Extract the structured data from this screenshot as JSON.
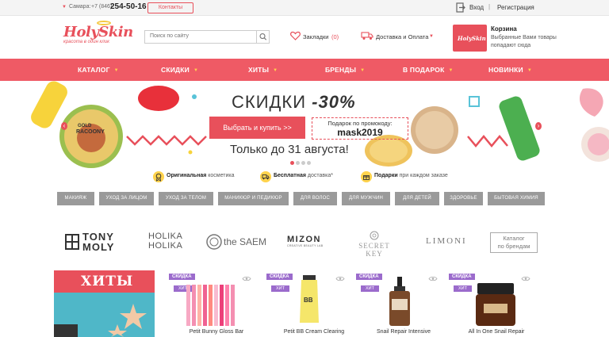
{
  "topbar": {
    "city": "Самара:",
    "phone_prefix": "+7 (846)",
    "phone_main": "254-50-16",
    "contacts": "Контакты",
    "login": "Вход",
    "separator": "|",
    "register": "Регистрация"
  },
  "header": {
    "logo": "HolySkin",
    "logo_sub": "красота в один клик",
    "search_placeholder": "Поиск по сайту",
    "bookmarks_label": "Закладки",
    "bookmarks_count": "(0)",
    "delivery": "Доставка и Оплата",
    "cart_logo": "HolySkin",
    "cart_title": "Корзина",
    "cart_desc": "Выбранные Вами товары попадают сюда"
  },
  "nav": [
    {
      "label": "КАТАЛОГ"
    },
    {
      "label": "СКИДКИ"
    },
    {
      "label": "ХИТЫ"
    },
    {
      "label": "БРЕНДЫ"
    },
    {
      "label": "В ПОДАРОК"
    },
    {
      "label": "НОВИНКИ"
    }
  ],
  "banner": {
    "title_main": "СКИДКИ",
    "title_off": "-30%",
    "buy_button": "Выбрать и купить >>",
    "promo_label": "Подарок по промокоду:",
    "promo_code": "mask2019",
    "until": "Только до 31 августа!"
  },
  "features": [
    {
      "bold": "Оригинальная",
      "rest": " косметика"
    },
    {
      "bold": "Бесплатная",
      "rest": " доставка*"
    },
    {
      "bold": "Подарки",
      "rest": " при каждом заказе"
    }
  ],
  "categories": [
    "МАКИЯЖ",
    "УХОД ЗА ЛИЦОМ",
    "УХОД ЗА ТЕЛОМ",
    "МАНИКЮР И ПЕДИКЮР",
    "ДЛЯ ВОЛОС",
    "ДЛЯ МУЖЧИН",
    "ДЛЯ ДЕТЕЙ",
    "ЗДОРОВЬЕ",
    "БЫТОВАЯ ХИМИЯ"
  ],
  "brands": {
    "tony_moly_1": "TONY",
    "tony_moly_2": "MOLY",
    "holika_1": "HOLIKA",
    "holika_2": "HOLIKA",
    "the_saem": "the SAEM",
    "mizon": "MIZON",
    "mizon_sub": "CREATIVE BEAUTY LAB",
    "secret_key": "SECRET KEY",
    "limoni": "LIMONI",
    "catalog_1": "Каталог",
    "catalog_2": "по брендам"
  },
  "hits": {
    "title": "ХИТЫ"
  },
  "products": [
    {
      "sale": "СКИДКА",
      "hit": "ХИТ",
      "name": "Petit Bunny Gloss Bar"
    },
    {
      "sale": "СКИДКА",
      "hit": "ХИТ",
      "name": "Petit BB Cream Clearing"
    },
    {
      "sale": "СКИДКА",
      "hit": "ХИТ",
      "name": "Snail Repair Intensive"
    },
    {
      "sale": "СКИДКА",
      "hit": "ХИТ",
      "name": "All In One Snail Repair"
    }
  ],
  "colors": {
    "accent": "#ef5a65",
    "badge": "#9b6bcc",
    "category_bg": "#9a9a9a"
  }
}
